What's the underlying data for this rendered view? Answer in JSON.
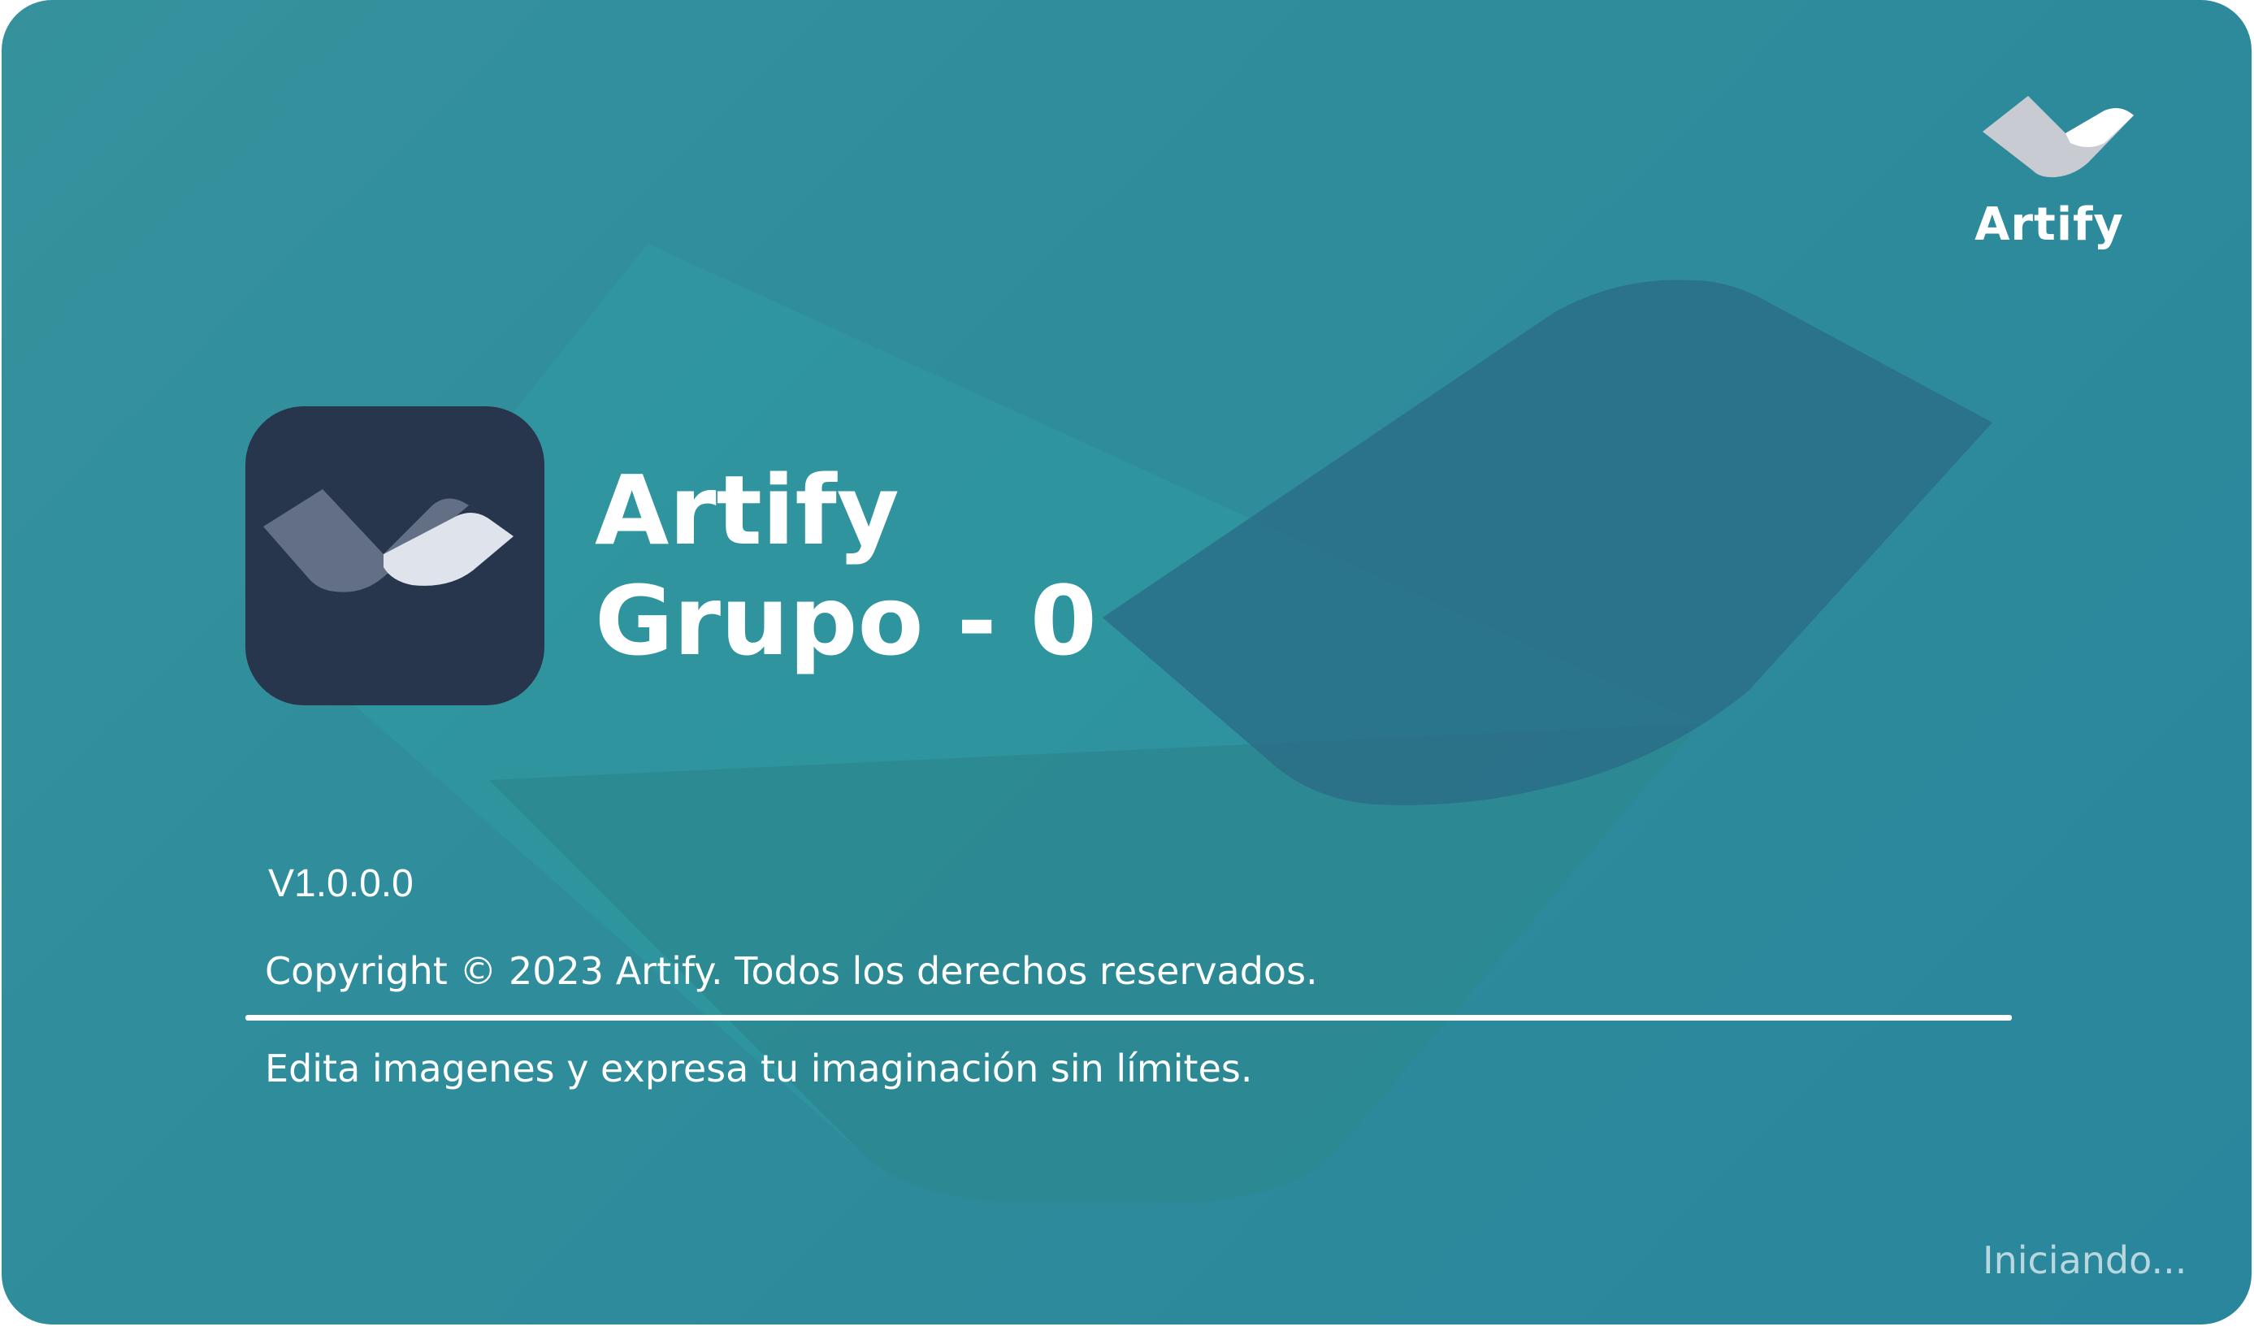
{
  "brand": {
    "corner_name": "Artify",
    "corner_logo_icon": "artify-logo-icon"
  },
  "app": {
    "icon": "artify-app-icon",
    "title_line1": "Artify",
    "title_line2": "Grupo - 0"
  },
  "info": {
    "version": "V1.0.0.0",
    "copyright": "Copyright © 2023 Artify. Todos los derechos reservados.",
    "tagline": "Edita imagenes y expresa tu imaginación sin límites."
  },
  "status": {
    "text": "Iniciando..."
  },
  "colors": {
    "background": "#2e8c9b",
    "icon_tile": "#27354d",
    "text": "#ffffff",
    "status_text": "#b9d8de"
  }
}
